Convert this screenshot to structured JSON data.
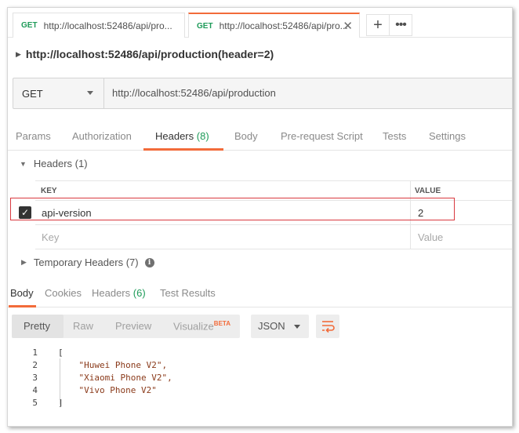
{
  "tabs": [
    {
      "method": "GET",
      "url": "http://localhost:52486/api/pro..."
    },
    {
      "method": "GET",
      "url": "http://localhost:52486/api/pro..."
    }
  ],
  "tab_controls": {
    "new": "+",
    "more": "•••",
    "close": "✕"
  },
  "request": {
    "name": "http://localhost:52486/api/production(header=2)",
    "method": "GET",
    "url": "http://localhost:52486/api/production"
  },
  "request_tabs": {
    "params": "Params",
    "authorization": "Authorization",
    "headers": "Headers",
    "headers_count": "(8)",
    "body": "Body",
    "prerequest": "Pre-request Script",
    "tests": "Tests",
    "settings": "Settings"
  },
  "headers_section": {
    "title": "Headers (1)",
    "columns": {
      "key": "KEY",
      "value": "VALUE"
    },
    "rows": [
      {
        "key": "api-version",
        "value": "2",
        "checked": true
      }
    ],
    "placeholder": {
      "key": "Key",
      "value": "Value"
    }
  },
  "temporary_headers": {
    "title": "Temporary Headers (7)"
  },
  "response_tabs": {
    "body": "Body",
    "cookies": "Cookies",
    "headers": "Headers",
    "headers_count": "(6)",
    "test_results": "Test Results"
  },
  "response_view": {
    "modes": [
      "Pretty",
      "Raw",
      "Preview",
      "Visualize"
    ],
    "beta": "BETA",
    "format": "JSON"
  },
  "response_body": {
    "lines": [
      {
        "no": "1",
        "text": "["
      },
      {
        "no": "2",
        "text": "    \"Huwei Phone V2\","
      },
      {
        "no": "3",
        "text": "    \"Xiaomi Phone V2\","
      },
      {
        "no": "4",
        "text": "    \"Vivo Phone V2\""
      },
      {
        "no": "5",
        "text": "]"
      }
    ]
  },
  "colors": {
    "accent": "#f26b3a",
    "get_method": "#1e9b59",
    "highlight": "#d9393f"
  }
}
